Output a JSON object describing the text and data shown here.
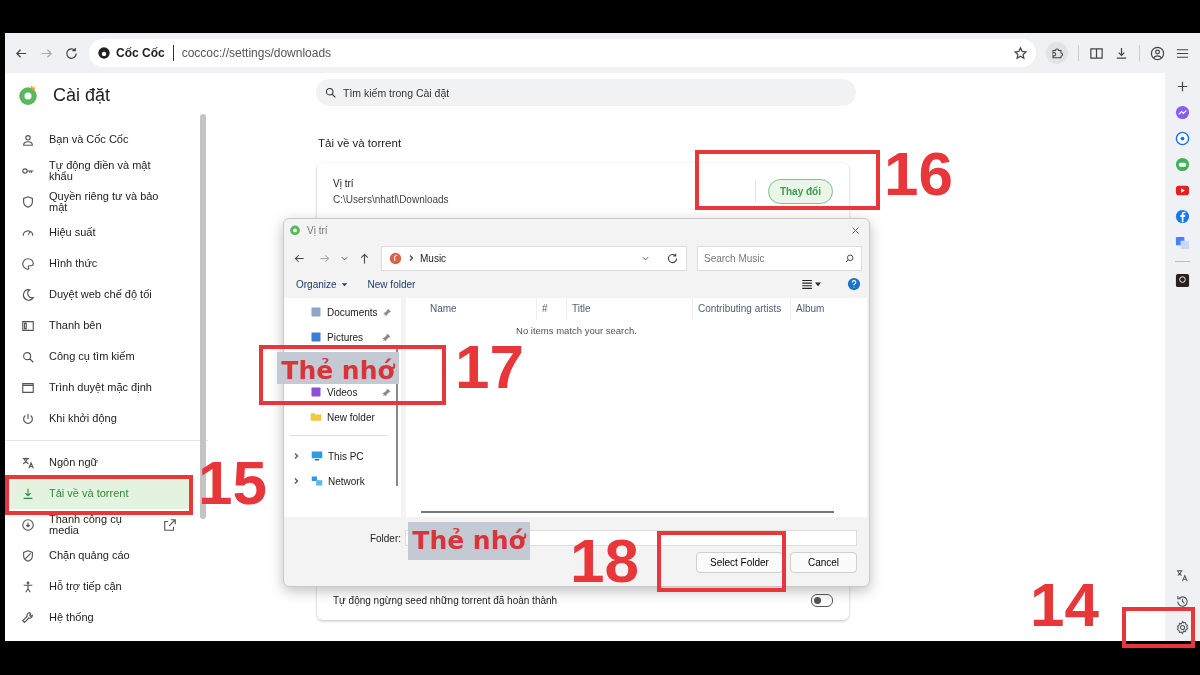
{
  "browser": {
    "site_name": "Cốc Cốc",
    "url": "coccoc://settings/downloads"
  },
  "settings": {
    "title": "Cài đặt",
    "search": {
      "placeholder": "Tìm kiếm trong Cài đặt"
    }
  },
  "sidebar": {
    "groups": [
      [
        {
          "label": "Bạn và Cốc Cốc",
          "selected": false,
          "external_link": false
        },
        {
          "label": "Tự động điền và mật khẩu",
          "selected": false,
          "external_link": false
        },
        {
          "label": "Quyền riêng tư và bảo mật",
          "selected": false,
          "external_link": false
        },
        {
          "label": "Hiệu suất",
          "selected": false,
          "external_link": false
        },
        {
          "label": "Hình thức",
          "selected": false,
          "external_link": false
        },
        {
          "label": "Duyệt web chế độ tối",
          "selected": false,
          "external_link": false
        },
        {
          "label": "Thanh bên",
          "selected": false,
          "external_link": false
        },
        {
          "label": "Công cụ tìm kiếm",
          "selected": false,
          "external_link": false
        },
        {
          "label": "Trình duyệt mặc định",
          "selected": false,
          "external_link": false
        },
        {
          "label": "Khi khởi động",
          "selected": false,
          "external_link": false
        }
      ],
      [
        {
          "label": "Ngôn ngữ",
          "selected": false,
          "external_link": false
        },
        {
          "label": "Tải về và torrent",
          "selected": true,
          "external_link": false
        },
        {
          "label": "Thanh công cụ media",
          "selected": false,
          "external_link": true
        },
        {
          "label": "Chặn quảng cáo",
          "selected": false,
          "external_link": false
        },
        {
          "label": "Hỗ trợ tiếp cận",
          "selected": false,
          "external_link": false
        },
        {
          "label": "Hệ thống",
          "selected": false,
          "external_link": false
        }
      ]
    ]
  },
  "section": {
    "title": "Tải về và torrent",
    "location": {
      "label": "Vị trí",
      "path": "C:\\Users\\nhatl\\Downloads",
      "button": "Thay đổi"
    },
    "auto_stop_seed": {
      "label": "Tự động ngừng seed những torrent đã hoàn thành",
      "on": false
    }
  },
  "dialog": {
    "title": "Vị trí",
    "breadcrumb": "Music",
    "search": {
      "placeholder": "Search Music"
    },
    "toolbar": [
      "Organize",
      "New folder"
    ],
    "nav": [
      {
        "label": "Documents",
        "pinned": true
      },
      {
        "label": "Pictures",
        "pinned": true
      },
      {
        "label": "Videos",
        "pinned": true
      },
      {
        "label": "New folder",
        "pinned": false
      }
    ],
    "locations": [
      "This PC",
      "Network"
    ],
    "columns": [
      "Name",
      "#",
      "Title",
      "Contributing artists",
      "Album"
    ],
    "empty_message": "No items match your search.",
    "folder_label": "Folder:",
    "buttons": [
      "Select Folder",
      "Cancel"
    ]
  },
  "annotations": [
    {
      "kind": "marker",
      "label": "16"
    },
    {
      "kind": "tag",
      "label": "Thẻ nhớ"
    },
    {
      "kind": "marker",
      "label": "17"
    },
    {
      "kind": "marker",
      "label": "15"
    },
    {
      "kind": "tag",
      "label": "Thẻ nhớ"
    },
    {
      "kind": "marker",
      "label": "18"
    },
    {
      "kind": "marker",
      "label": "14"
    }
  ]
}
